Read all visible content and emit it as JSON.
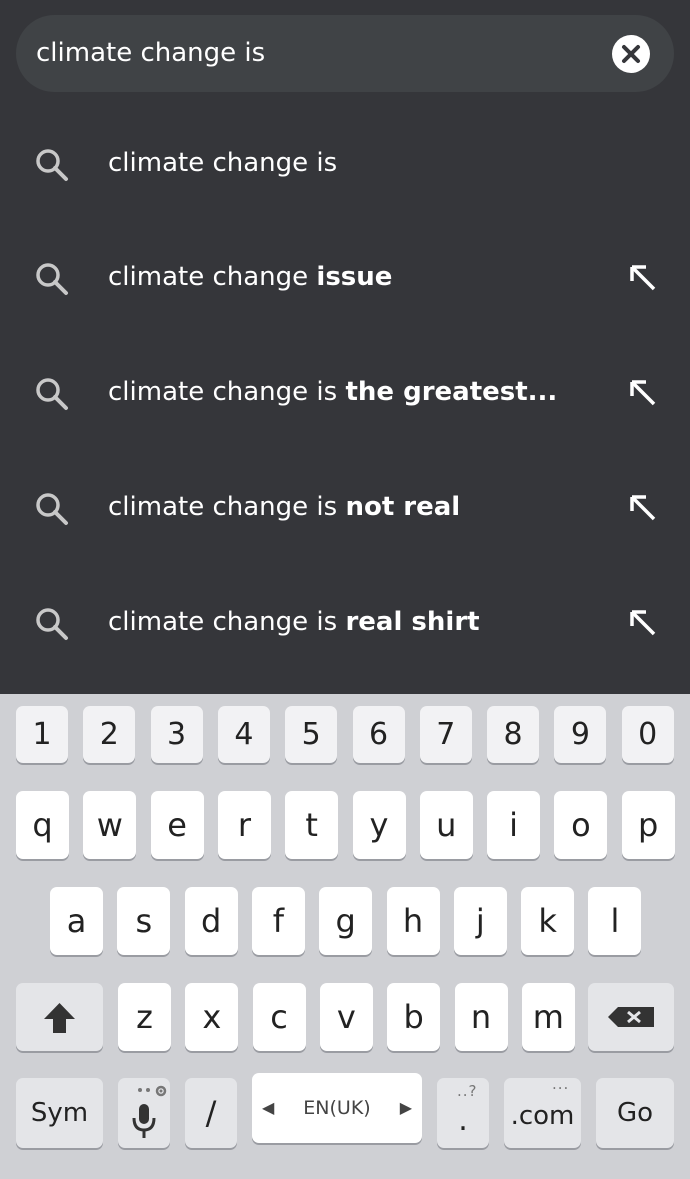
{
  "search": {
    "query": "climate change is",
    "clear_icon": "close-circle-icon"
  },
  "suggestions": [
    {
      "prefix": "climate change is",
      "suffix": "",
      "has_fill": false
    },
    {
      "prefix": "climate change ",
      "suffix": "issue",
      "has_fill": true
    },
    {
      "prefix": "climate change is ",
      "suffix": "the greatest...",
      "has_fill": true
    },
    {
      "prefix": "climate change is ",
      "suffix": "not real",
      "has_fill": true
    },
    {
      "prefix": "climate change is ",
      "suffix": "real shirt",
      "has_fill": true
    }
  ],
  "keyboard": {
    "numbers": [
      "1",
      "2",
      "3",
      "4",
      "5",
      "6",
      "7",
      "8",
      "9",
      "0"
    ],
    "row1": [
      "q",
      "w",
      "e",
      "r",
      "t",
      "y",
      "u",
      "i",
      "o",
      "p"
    ],
    "row2": [
      "a",
      "s",
      "d",
      "f",
      "g",
      "h",
      "j",
      "k",
      "l"
    ],
    "row3": [
      "z",
      "x",
      "c",
      "v",
      "b",
      "n",
      "m"
    ],
    "sym_label": "Sym",
    "slash_label": "/",
    "language_label": "EN(UK)",
    "period_label": ".",
    "period_hint": "..?",
    "dotcom_label": ".com",
    "dotcom_hint": "...",
    "go_label": "Go",
    "mic_icon": "microphone-icon",
    "settings_icon": "gear-icon",
    "shift_icon": "shift-arrow-icon",
    "backspace_icon": "backspace-icon"
  },
  "colors": {
    "background": "#35363a",
    "search_bar": "#404346",
    "keyboard_bg": "#cfd0d4"
  }
}
